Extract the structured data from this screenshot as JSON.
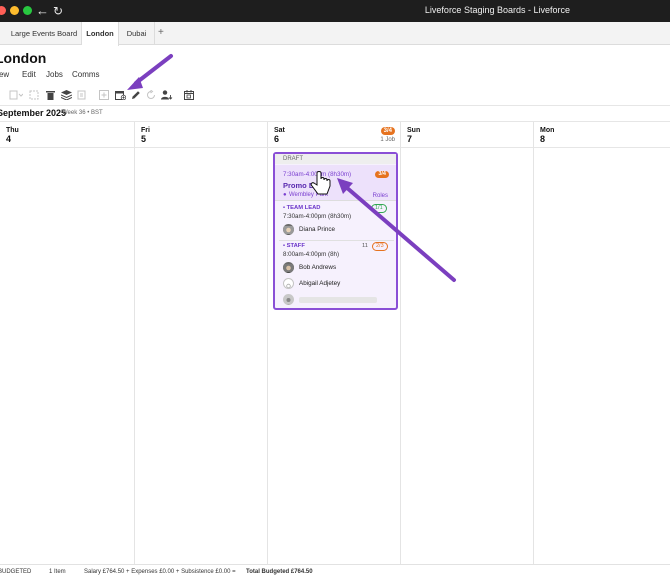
{
  "window": {
    "title": "Liveforce Staging Boards - Liveforce"
  },
  "tabs": [
    {
      "label": "Large Events Board"
    },
    {
      "label": "London"
    },
    {
      "label": "Dubai"
    }
  ],
  "tab_add": "+",
  "board": {
    "title": "London",
    "menu": [
      "View",
      "Edit",
      "Jobs",
      "Comms"
    ]
  },
  "week": {
    "title": "September 2025",
    "subtitle": "Week 36 • BST"
  },
  "days": [
    {
      "name": "Thu",
      "num": "4"
    },
    {
      "name": "Fri",
      "num": "5"
    },
    {
      "name": "Sat",
      "num": "6",
      "badge": "3/4",
      "jobs": "1 Job"
    },
    {
      "name": "Sun",
      "num": "7"
    },
    {
      "name": "Mon",
      "num": "8"
    }
  ],
  "job": {
    "status": "DRAFT",
    "time": "7:30am-4:00pm (8h30m)",
    "badge": "3/4",
    "name": "Promo Day",
    "location": "Wembley Park",
    "roles_link": "Roles",
    "team_lead": {
      "label": "• TEAM LEAD",
      "count": "1/1",
      "time": "7:30am-4:00pm (8h30m)",
      "people": [
        "Diana Prince"
      ]
    },
    "staff": {
      "label": "• STAFF",
      "extra": "11",
      "count": "2/3",
      "time": "8:00am-4:00pm (8h)",
      "people": [
        "Bob Andrews",
        "Abigail Adjetey"
      ]
    }
  },
  "footer": {
    "budget_label": "BUDGETED",
    "items": "1 Item",
    "breakdown": "Salary £764.50 + Expenses £0.00 + Subsistence £0.00 =",
    "total": "Total Budgeted £764.50"
  },
  "colors": {
    "accent": "#8a4fd6",
    "badge": "#e6731f",
    "arrow": "#7b3fbf"
  },
  "icons": {
    "copy": "copy-icon",
    "trash": "trash-icon",
    "layers": "layers-icon",
    "add": "add-job-icon",
    "calendar_add": "calendar-add-icon",
    "edit": "pencil-icon",
    "refresh": "refresh-icon",
    "assign": "assign-user-icon",
    "calendar": "calendar-icon"
  }
}
